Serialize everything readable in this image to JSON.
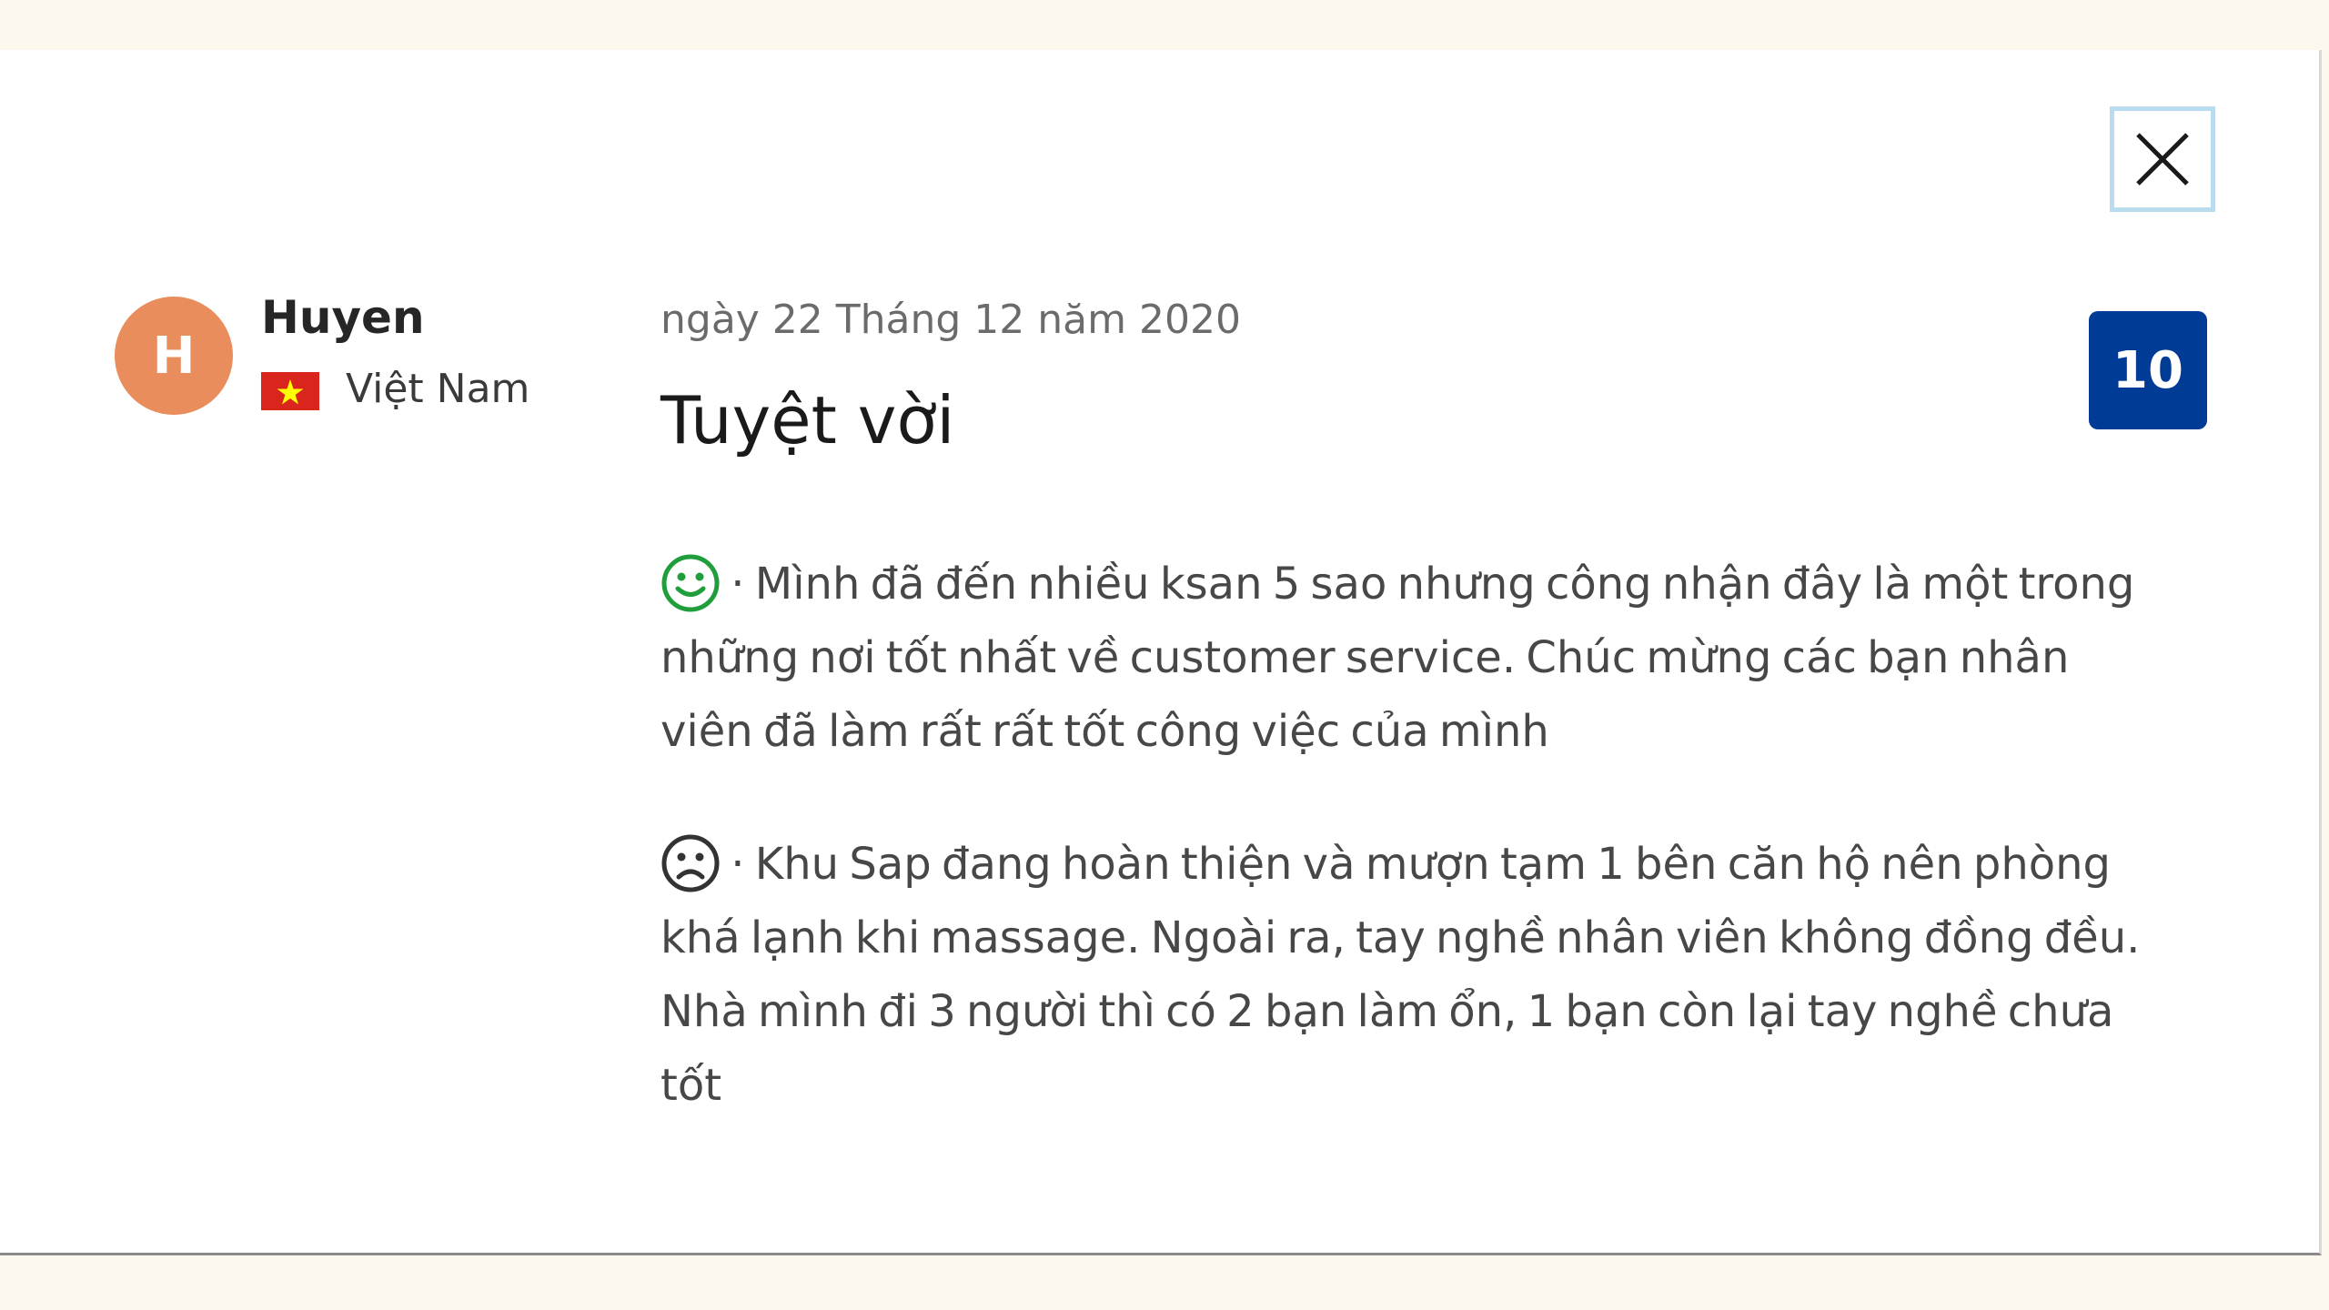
{
  "reviewer": {
    "initial": "H",
    "name": "Huyen",
    "country": "Việt Nam",
    "flag_icon": "vietnam-flag-icon"
  },
  "review": {
    "date": "ngày 22 Tháng 12 năm 2020",
    "title": "Tuyệt vời",
    "score": "10",
    "positive": {
      "icon": "smiley-face-icon",
      "text": "· Mình đã đến nhiều ksan 5 sao nhưng công nhận đây là một trong những nơi tốt nhất về customer service. Chúc mừng các bạn nhân viên đã làm rất rất tốt công việc của mình"
    },
    "negative": {
      "icon": "sad-face-icon",
      "text": "· Khu Sap đang hoàn thiện và mượn tạm 1 bên căn hộ nên phòng khá lạnh khi massage. Ngoài ra, tay nghề nhân viên không đồng đều. Nhà mình đi 3 người thì có 2 bạn làm ổn, 1 bạn còn lại tay nghề chưa tốt"
    }
  },
  "colors": {
    "avatar": "#e98d5c",
    "score_badge": "#003b95",
    "positive_icon": "#1f9e3b",
    "negative_icon": "#333333",
    "close_focus": "#b9dcef"
  }
}
